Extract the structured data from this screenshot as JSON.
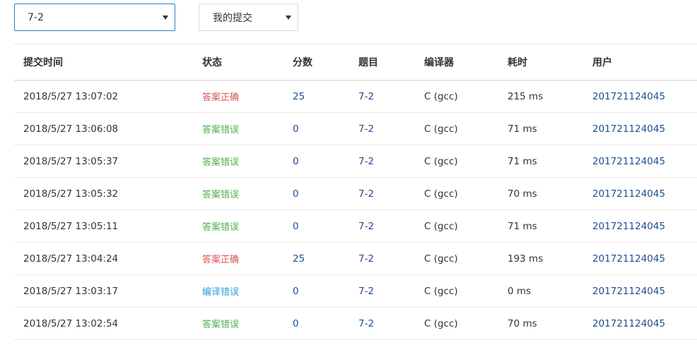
{
  "filters": {
    "problem": "7-2",
    "scope": "我的提交"
  },
  "colors": {
    "accepted": "#d9534f",
    "wrong_answer": "#4caf50",
    "compile_error": "#2d9cdb",
    "link": "#1f4e8c"
  },
  "table": {
    "headers": {
      "time": "提交时间",
      "status": "状态",
      "score": "分数",
      "problem": "题目",
      "compiler": "编译器",
      "cost": "耗时",
      "user": "用户"
    },
    "rows": [
      {
        "time": "2018/5/27 13:07:02",
        "status": "答案正确",
        "status_type": "accepted",
        "score": "25",
        "problem": "7-2",
        "compiler": "C (gcc)",
        "cost": "215 ms",
        "user": "201721124045"
      },
      {
        "time": "2018/5/27 13:06:08",
        "status": "答案错误",
        "status_type": "wrong_answer",
        "score": "0",
        "problem": "7-2",
        "compiler": "C (gcc)",
        "cost": "71 ms",
        "user": "201721124045"
      },
      {
        "time": "2018/5/27 13:05:37",
        "status": "答案错误",
        "status_type": "wrong_answer",
        "score": "0",
        "problem": "7-2",
        "compiler": "C (gcc)",
        "cost": "71 ms",
        "user": "201721124045"
      },
      {
        "time": "2018/5/27 13:05:32",
        "status": "答案错误",
        "status_type": "wrong_answer",
        "score": "0",
        "problem": "7-2",
        "compiler": "C (gcc)",
        "cost": "70 ms",
        "user": "201721124045"
      },
      {
        "time": "2018/5/27 13:05:11",
        "status": "答案错误",
        "status_type": "wrong_answer",
        "score": "0",
        "problem": "7-2",
        "compiler": "C (gcc)",
        "cost": "71 ms",
        "user": "201721124045"
      },
      {
        "time": "2018/5/27 13:04:24",
        "status": "答案正确",
        "status_type": "accepted",
        "score": "25",
        "problem": "7-2",
        "compiler": "C (gcc)",
        "cost": "193 ms",
        "user": "201721124045"
      },
      {
        "time": "2018/5/27 13:03:17",
        "status": "编译错误",
        "status_type": "compile_error",
        "score": "0",
        "problem": "7-2",
        "compiler": "C (gcc)",
        "cost": "0 ms",
        "user": "201721124045"
      },
      {
        "time": "2018/5/27 13:02:54",
        "status": "答案错误",
        "status_type": "wrong_answer",
        "score": "0",
        "problem": "7-2",
        "compiler": "C (gcc)",
        "cost": "70 ms",
        "user": "201721124045"
      }
    ]
  }
}
